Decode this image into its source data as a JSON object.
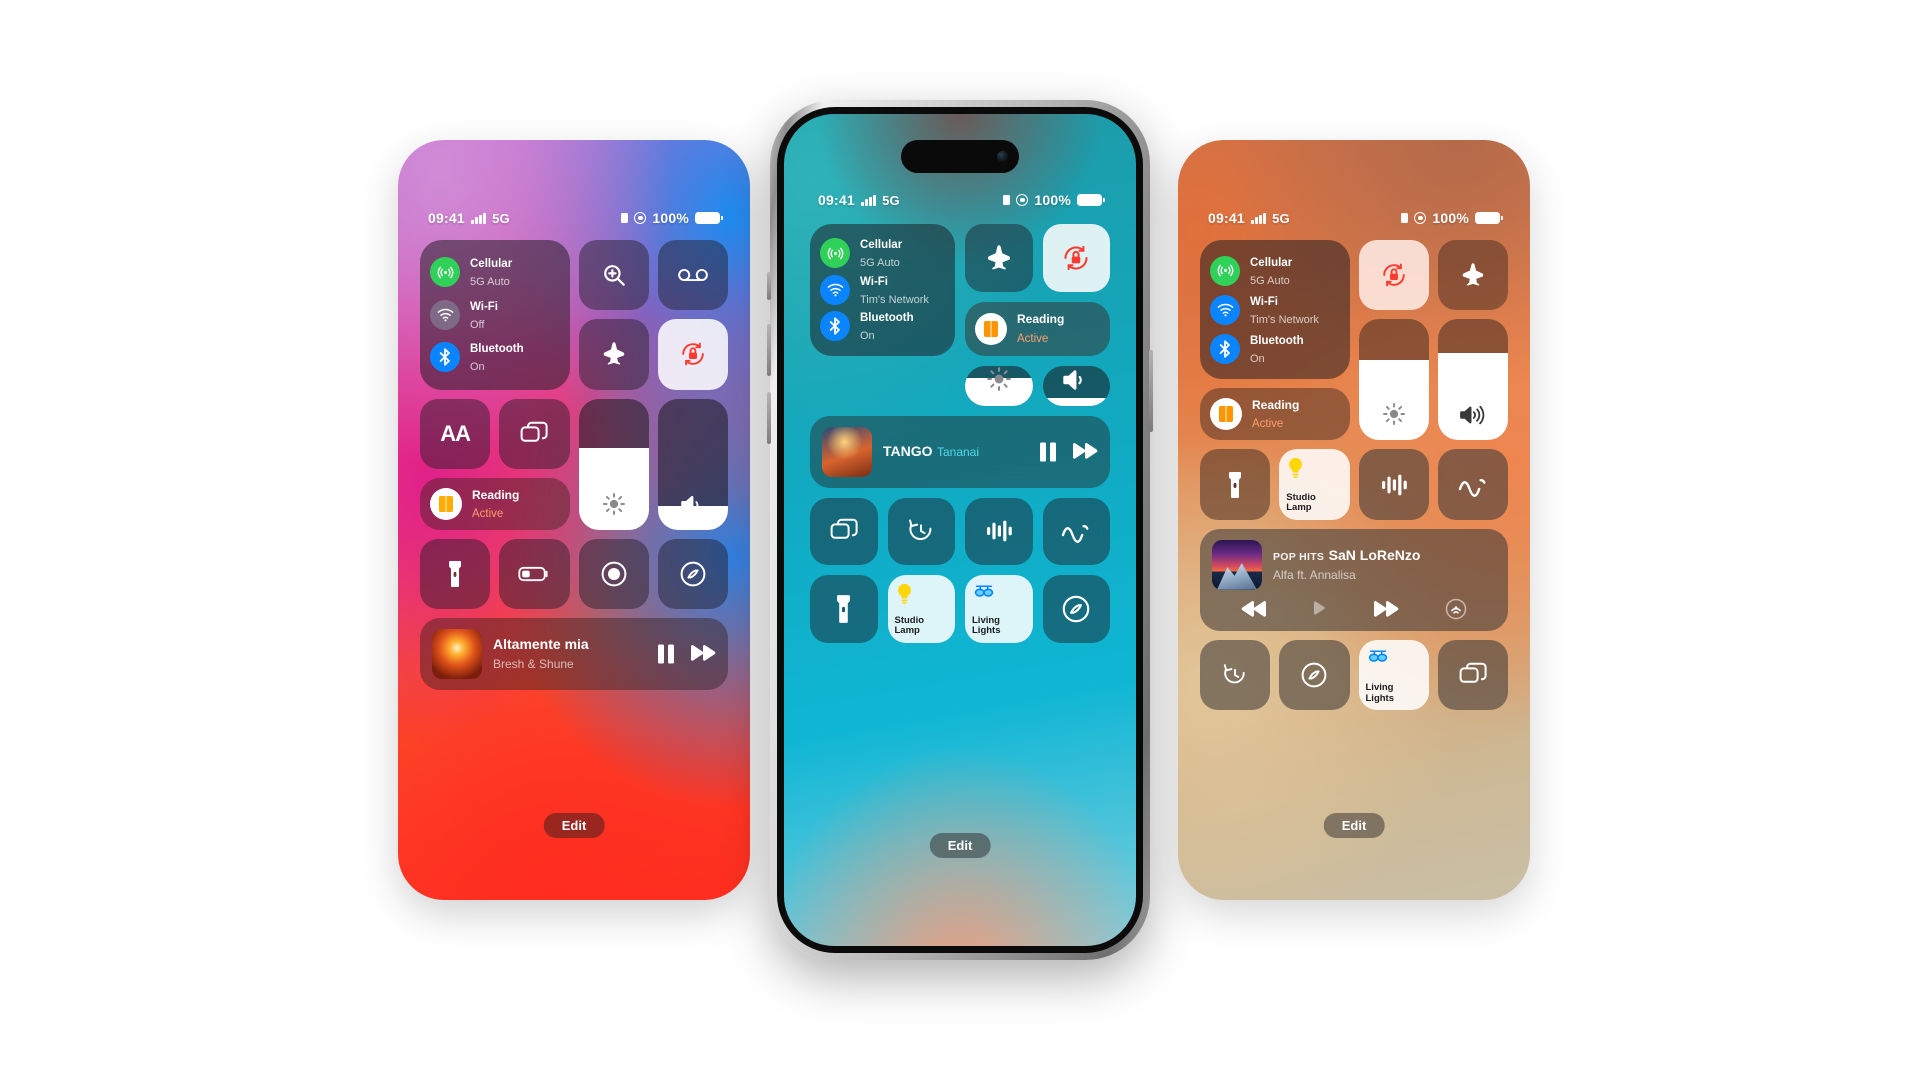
{
  "meta": {
    "scene": "Three iPhones showing iOS Control Center variants",
    "accents": {
      "green": "#30d158",
      "blue": "#0a84ff",
      "red": "#ff3b30",
      "orange_text": "#ff9f6e",
      "lamp_yellow": "#ffd60a"
    }
  },
  "status_bar": {
    "time": "09:41",
    "network": "5G",
    "battery_percent": "100%",
    "icons": [
      "signal-bars-icon",
      "sim-icon",
      "focus-icon",
      "battery-icon"
    ]
  },
  "common": {
    "edit_label": "Edit",
    "connectivity": {
      "cellular": {
        "title": "Cellular",
        "subtitle": "5G Auto",
        "icon": "cellular-icon"
      },
      "wifi_off": {
        "title": "Wi-Fi",
        "subtitle": "Off",
        "icon": "wifi-icon"
      },
      "wifi_on": {
        "title": "Wi-Fi",
        "subtitle": "Tim's Network",
        "icon": "wifi-icon"
      },
      "bluetooth": {
        "title": "Bluetooth",
        "subtitle": "On",
        "icon": "bluetooth-icon"
      }
    },
    "reading": {
      "title": "Reading",
      "status": "Active",
      "icon": "book-icon"
    },
    "studio_lamp": {
      "label": "Studio\nLamp",
      "line1": "Studio",
      "line2": "Lamp",
      "icon": "lightbulb-icon"
    },
    "living_lights": {
      "label": "Living\nLights",
      "line1": "Living",
      "line2": "Lights",
      "icon": "ceiling-lights-icon"
    }
  },
  "phone_left": {
    "name": "control-center-purple-red",
    "tiles": [
      {
        "name": "magnifier-zoom-button",
        "icon": "magnifier-plus-icon",
        "state": "off"
      },
      {
        "name": "voicemail-button",
        "icon": "voicemail-icon",
        "state": "off"
      },
      {
        "name": "airplane-mode-button",
        "icon": "airplane-icon",
        "state": "off"
      },
      {
        "name": "rotation-lock-button",
        "icon": "rotation-lock-icon",
        "state": "on"
      },
      {
        "name": "text-size-button",
        "icon": "text-size-icon",
        "label": "AA",
        "state": "off"
      },
      {
        "name": "screen-mirroring-button",
        "icon": "screen-mirroring-icon",
        "state": "off"
      },
      {
        "name": "flashlight-button",
        "icon": "flashlight-icon",
        "state": "off"
      },
      {
        "name": "low-power-button",
        "icon": "battery-low-icon",
        "state": "off"
      },
      {
        "name": "screen-record-button",
        "icon": "record-icon",
        "state": "off"
      },
      {
        "name": "shazam-button",
        "icon": "shazam-icon",
        "state": "off"
      }
    ],
    "brightness": {
      "name": "brightness-slider",
      "icon": "sun-icon",
      "value_percent": 62
    },
    "volume": {
      "name": "volume-slider",
      "icon": "speaker-icon",
      "value_percent": 18
    },
    "player": {
      "title": "Altamente mia",
      "artist": "Bresh & Shune",
      "artwork": "fire-artwork",
      "controls": [
        "pause-button",
        "next-button"
      ]
    }
  },
  "phone_center": {
    "name": "control-center-teal",
    "tiles": [
      {
        "name": "airplane-mode-button",
        "icon": "airplane-icon",
        "state": "off"
      },
      {
        "name": "rotation-lock-button",
        "icon": "rotation-lock-icon",
        "state": "on"
      },
      {
        "name": "screen-mirroring-button",
        "icon": "screen-mirroring-icon",
        "state": "off"
      },
      {
        "name": "timer-button",
        "icon": "timer-icon",
        "state": "off"
      },
      {
        "name": "hearing-button",
        "icon": "hearing-levels-icon",
        "state": "off"
      },
      {
        "name": "sleep-sounds-button",
        "icon": "wave-icon",
        "state": "off"
      },
      {
        "name": "flashlight-button",
        "icon": "flashlight-icon",
        "state": "off"
      },
      {
        "name": "studio-lamp-button",
        "icon": "lightbulb-icon",
        "state": "on"
      },
      {
        "name": "living-lights-button",
        "icon": "ceiling-lights-icon",
        "state": "on"
      },
      {
        "name": "shazam-button",
        "icon": "shazam-icon",
        "state": "off"
      }
    ],
    "brightness": {
      "name": "brightness-slider",
      "icon": "sun-icon",
      "value_percent": 70
    },
    "volume": {
      "name": "volume-slider",
      "icon": "speaker-icon",
      "value_percent": 20
    },
    "player": {
      "title": "TANGO",
      "artist": "Tananai",
      "artwork": "tango-artwork",
      "controls": [
        "pause-button",
        "next-button"
      ]
    }
  },
  "phone_right": {
    "name": "control-center-orange",
    "tiles": [
      {
        "name": "rotation-lock-button",
        "icon": "rotation-lock-icon",
        "state": "on"
      },
      {
        "name": "airplane-mode-button",
        "icon": "airplane-icon",
        "state": "off"
      },
      {
        "name": "flashlight-button",
        "icon": "flashlight-icon",
        "state": "off"
      },
      {
        "name": "studio-lamp-button",
        "icon": "lightbulb-icon",
        "state": "on"
      },
      {
        "name": "hearing-button",
        "icon": "hearing-levels-icon",
        "state": "off"
      },
      {
        "name": "sleep-sounds-button",
        "icon": "wave-icon",
        "state": "off"
      },
      {
        "name": "timer-button",
        "icon": "timer-icon",
        "state": "off"
      },
      {
        "name": "shazam-button",
        "icon": "shazam-icon",
        "state": "off"
      },
      {
        "name": "living-lights-button",
        "icon": "ceiling-lights-icon",
        "state": "on"
      },
      {
        "name": "screen-mirroring-button",
        "icon": "screen-mirroring-icon",
        "state": "off"
      }
    ],
    "brightness": {
      "name": "brightness-slider",
      "icon": "sun-icon",
      "value_percent": 66
    },
    "volume": {
      "name": "volume-slider",
      "icon": "speaker-icon",
      "value_percent": 72
    },
    "player": {
      "kicker": "POP HITS",
      "title": "SaN LoReNzo",
      "artist": "Alfa ft. Annalisa",
      "artwork": "mountain-artwork",
      "controls": [
        "rewind-button",
        "play-button",
        "fast-forward-button",
        "airplay-button"
      ]
    }
  }
}
